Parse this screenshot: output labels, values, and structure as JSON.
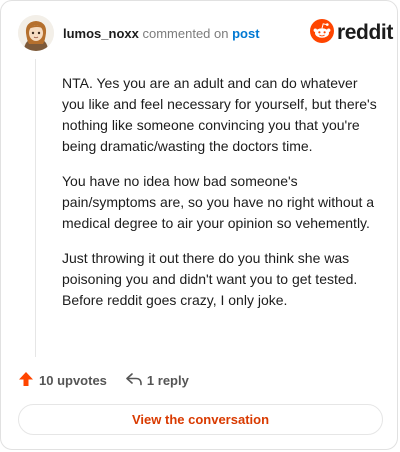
{
  "comment": {
    "username": "lumos_noxx",
    "action_text": "commented on",
    "post_link_text": "post",
    "paragraphs": [
      "NTA. Yes you are an adult and can do whatever you like and feel necessary for yourself, but there's nothing like someone convincing you that you're being dramatic/wasting the doctors time.",
      "You have no idea how bad someone's pain/symptoms are, so you have no right without a medical degree to air your opinion so vehemently.",
      "Just throwing it out there do you think she was poisoning you and didn't want you to get tested. Before reddit goes crazy, I only joke."
    ]
  },
  "brand": {
    "wordmark": "reddit",
    "logo_icon": "reddit-snoo-icon",
    "color": "#ff4500"
  },
  "footer": {
    "upvotes_label": "10 upvotes",
    "upvote_icon": "upvote-arrow-icon",
    "upvote_color": "#ff4500",
    "replies_label": "1 reply",
    "reply_icon": "reply-arrow-icon"
  },
  "cta": {
    "label": "View the conversation",
    "color": "#d93a00"
  }
}
